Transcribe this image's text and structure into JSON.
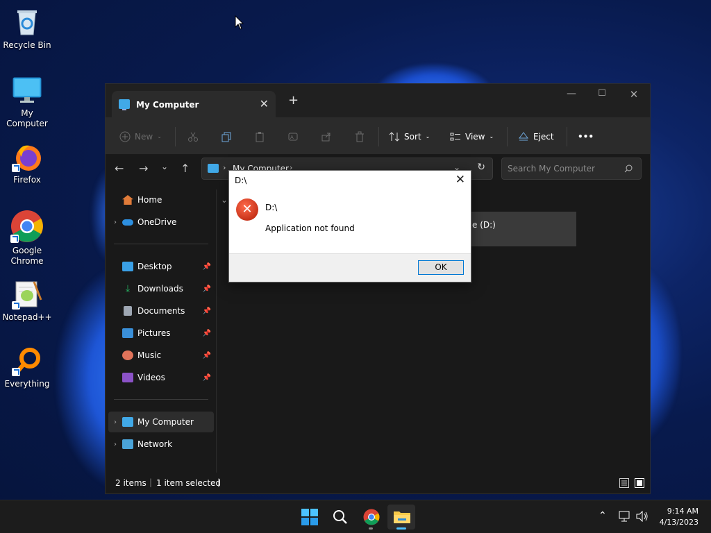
{
  "desktop": {
    "icons": [
      {
        "label": "Recycle Bin",
        "icon": "recycle-bin-icon"
      },
      {
        "label": "My Computer",
        "icon": "computer-icon"
      },
      {
        "label": "Firefox",
        "icon": "firefox-icon"
      },
      {
        "label": "Google Chrome",
        "icon": "chrome-icon"
      },
      {
        "label": "Notepad++",
        "icon": "notepadpp-icon"
      },
      {
        "label": "Everything",
        "icon": "everything-icon"
      }
    ]
  },
  "explorer": {
    "tab_title": "My Computer",
    "toolbar": {
      "new_label": "New",
      "sort_label": "Sort",
      "view_label": "View",
      "eject_label": "Eject",
      "more_label": "•••"
    },
    "address": "My Computer",
    "search_placeholder": "Search My Computer",
    "sidebar": {
      "home": "Home",
      "onedrive": "OneDrive",
      "quick": [
        {
          "label": "Desktop",
          "color": "#3aa0e6"
        },
        {
          "label": "Downloads",
          "color": "#27ae60"
        },
        {
          "label": "Documents",
          "color": "#9ea7b3"
        },
        {
          "label": "Pictures",
          "color": "#3a8fd8"
        },
        {
          "label": "Music",
          "color": "#e0735a"
        },
        {
          "label": "Videos",
          "color": "#8b52c7"
        }
      ],
      "mycomputer": "My Computer",
      "network": "Network"
    },
    "drive_label": "e (D:)",
    "status": {
      "items": "2 items",
      "selected": "1 item selected"
    }
  },
  "dialog": {
    "title": "D:\\",
    "line1": "D:\\",
    "message": "Application not found",
    "ok_label": "OK"
  },
  "taskbar": {
    "time": "9:14 AM",
    "date": "4/13/2023"
  }
}
